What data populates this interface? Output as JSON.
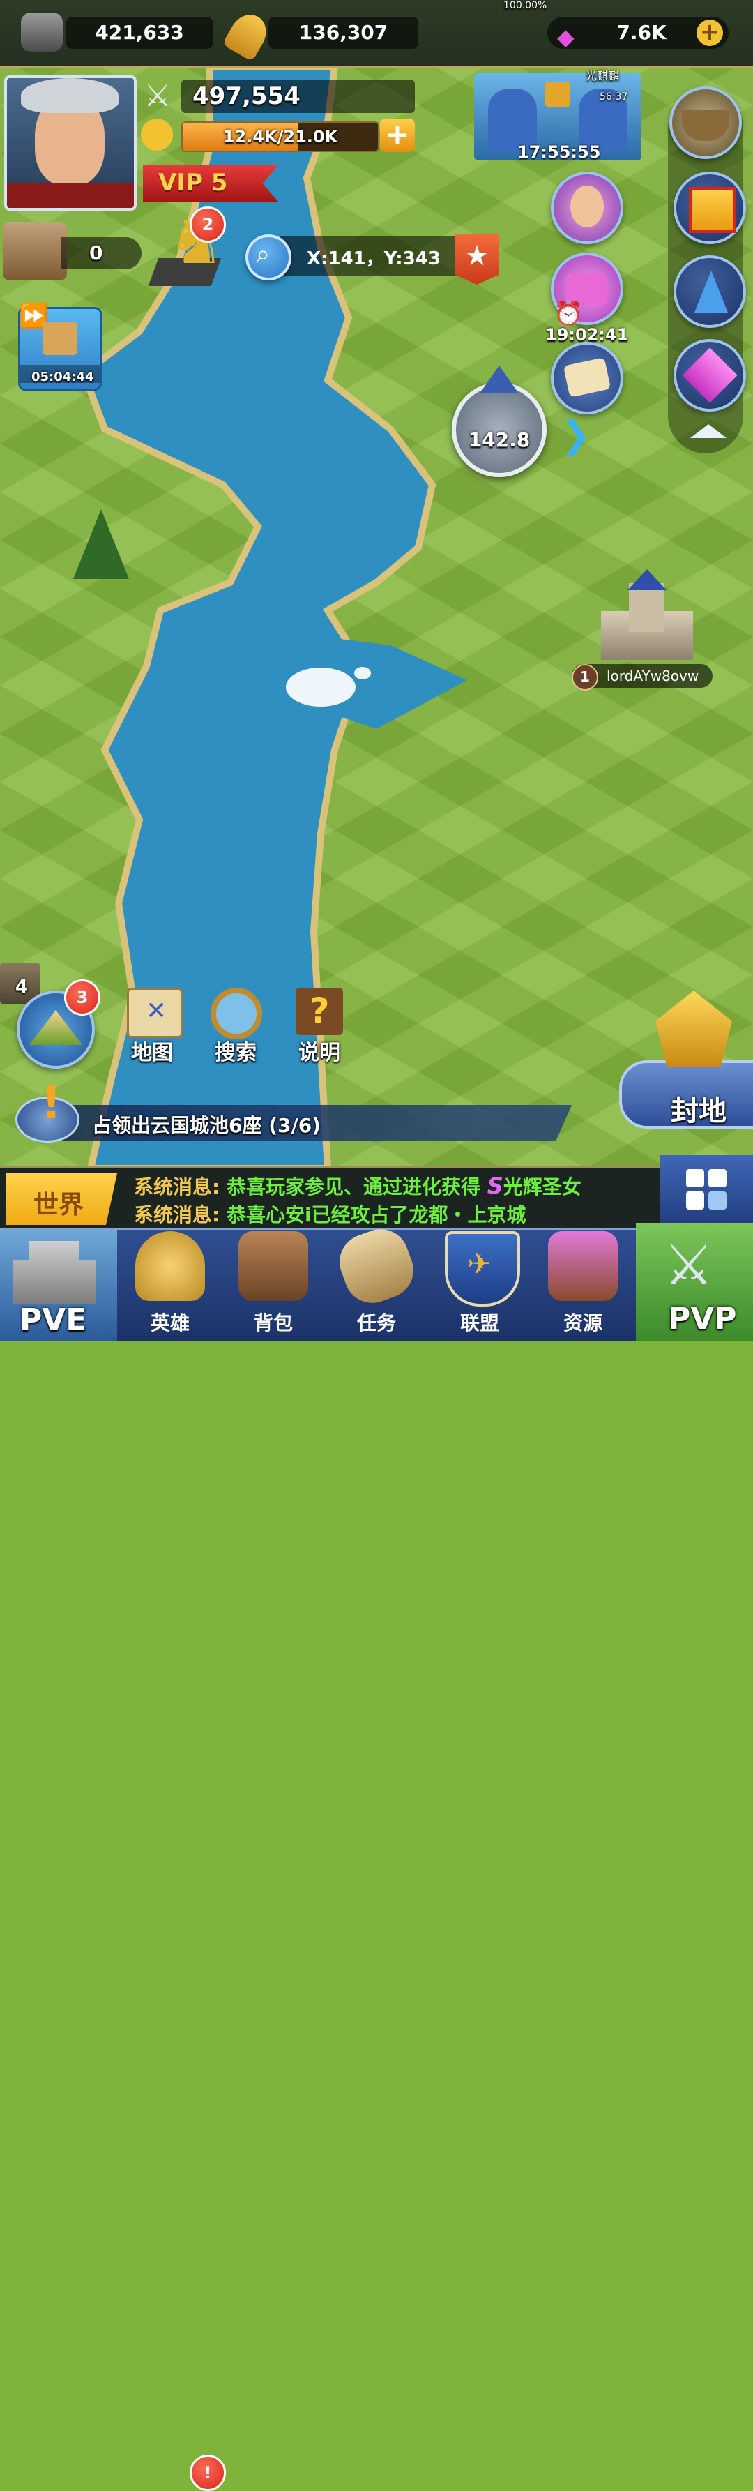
{
  "resources": {
    "stone": "421,633",
    "grain": "136,307",
    "gems": "7.6K"
  },
  "player": {
    "power": "497,554",
    "exp": "12.4K/21.0K",
    "exp_progress": 0.59,
    "vip": "VIP 5"
  },
  "left_panel": {
    "castle_count": "0",
    "chess_badge": "2",
    "boost_timer": "05:04:44"
  },
  "coords": {
    "text": "X:141，Y:343"
  },
  "events": {
    "battle_timer": "17:55:55",
    "battle_top_text": "100.00%",
    "battle_name_partial": "光麒麟",
    "battle_sub_timer": "56:37",
    "chest_timer": "19:02:41"
  },
  "map": {
    "tower_distance": "142.8",
    "enemy_level": "1",
    "enemy_name": "lordAYw8ovw",
    "mini_level": "4"
  },
  "tools": {
    "map_badge": "3",
    "map_label": "地图",
    "search_label": "搜索",
    "help_label": "说明"
  },
  "quest": {
    "text": "占领出云国城池6座 (3/6)"
  },
  "fief": {
    "label": "封地"
  },
  "chat": {
    "channel": "世界",
    "messages": [
      {
        "prefix": "系统消息:",
        "body": "恭喜玩家参见、通过进化获得",
        "tail": "光辉圣女",
        "tier": "S"
      },
      {
        "prefix": "系统消息:",
        "body": "恭喜心安i已经攻占了龙都・上京城",
        "tail": "",
        "tier": ""
      }
    ]
  },
  "nav": {
    "pve": "PVE",
    "pvp": "PVP",
    "hero_badge": "!",
    "items": [
      {
        "label": "英雄"
      },
      {
        "label": "背包"
      },
      {
        "label": "任务"
      },
      {
        "label": "联盟"
      },
      {
        "label": "资源"
      }
    ]
  },
  "colors": {
    "river": "#2e8fc0",
    "grass": "#86b83f",
    "nav_blue": "#2f4f91",
    "chat_green": "#6df03a",
    "gold": "#f2b838"
  }
}
